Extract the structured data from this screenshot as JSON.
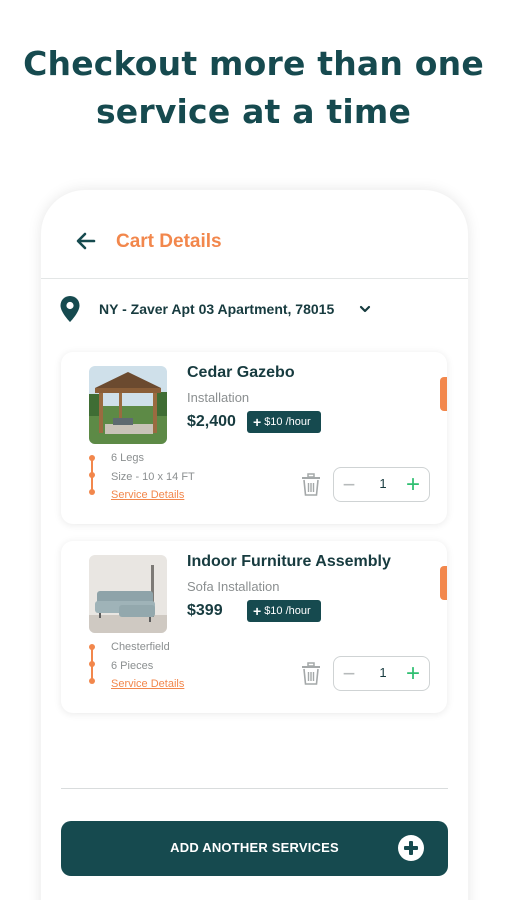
{
  "headline": {
    "line1": "Checkout more than one",
    "line2": "service at a time"
  },
  "header": {
    "title": "Cart Details",
    "back_icon": "arrow-left-icon"
  },
  "location": {
    "address": "NY - Zaver Apt 03 Apartment, 78015",
    "icon": "map-pin-icon"
  },
  "cart_items": [
    {
      "name": "Cedar Gazebo",
      "subtitle": "Installation",
      "price": "$2,400",
      "rate": "$10 /hour",
      "details": [
        "6 Legs",
        "Size - 10 x 14 FT"
      ],
      "link": "Service Details",
      "quantity": "1"
    },
    {
      "name": "Indoor Furniture Assembly",
      "subtitle": "Sofa Installation",
      "price": "$399",
      "rate": "$10 /hour",
      "details": [
        "Chesterfield",
        "6 Pieces"
      ],
      "link": "Service Details",
      "quantity": "1"
    }
  ],
  "stepper": {
    "minus": "−",
    "plus": "+"
  },
  "add_button": {
    "label": "ADD ANOTHER SERVICES"
  },
  "colors": {
    "primary": "#164a4f",
    "accent": "#f2874c",
    "plus_green": "#2fbf71"
  }
}
